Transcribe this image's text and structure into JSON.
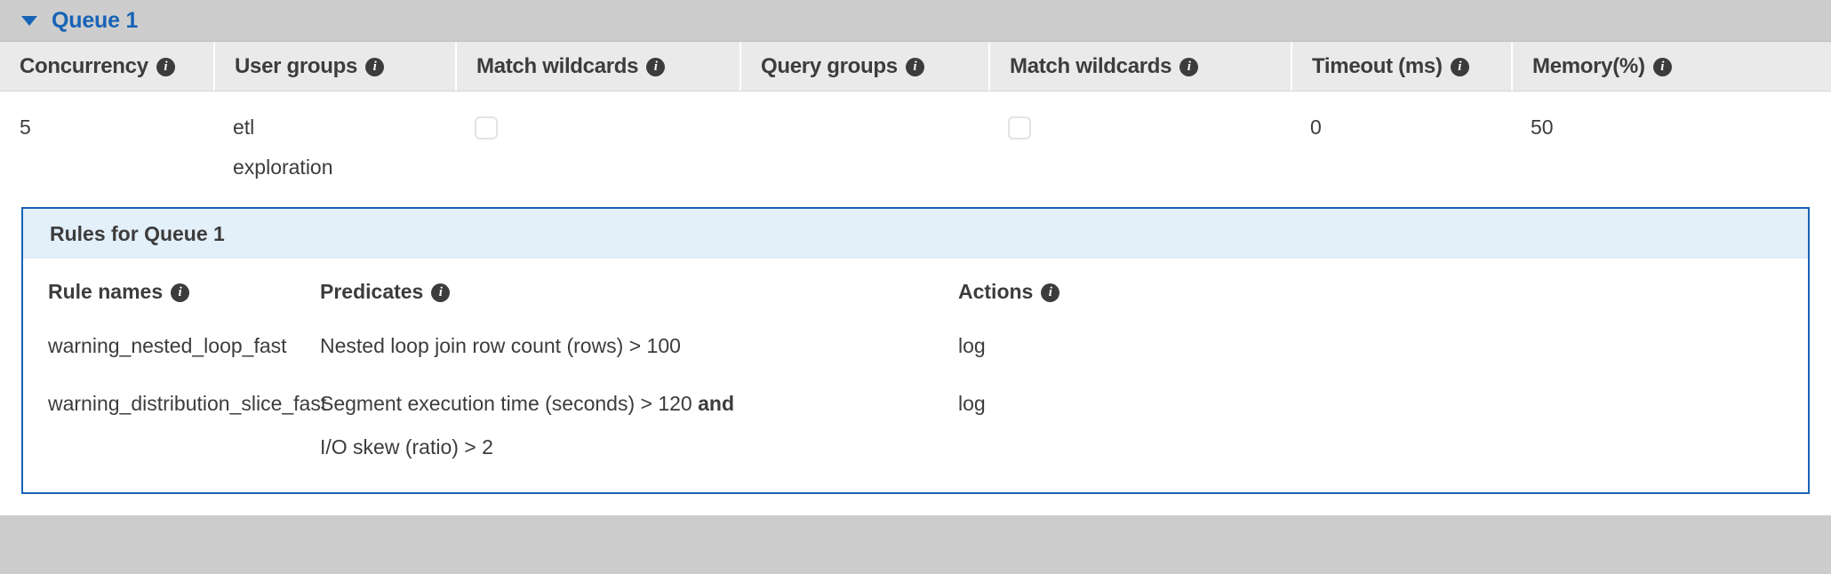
{
  "queue": {
    "title": "Queue 1",
    "disclosure_icon": "chevron-down-icon",
    "expanded": true,
    "accent_color": "#1763b6",
    "header_bg": "#cdcdcd"
  },
  "main_table": {
    "info_icon_glyph": "i",
    "columns": [
      {
        "label": "Concurrency",
        "info_icon": "info-icon"
      },
      {
        "label": "User groups",
        "info_icon": "info-icon"
      },
      {
        "label": "Match wildcards",
        "info_icon": "info-icon"
      },
      {
        "label": "Query groups",
        "info_icon": "info-icon"
      },
      {
        "label": "Match wildcards",
        "info_icon": "info-icon"
      },
      {
        "label": "Timeout (ms)",
        "info_icon": "info-icon"
      },
      {
        "label": "Memory(%)",
        "info_icon": "info-icon"
      }
    ],
    "row": {
      "concurrency": "5",
      "user_groups": [
        "etl",
        "exploration"
      ],
      "user_groups_match_wildcards": false,
      "query_groups": "",
      "query_groups_match_wildcards": false,
      "timeout_ms": "0",
      "memory_percent": "50"
    }
  },
  "rules_panel": {
    "title": "Rules for Queue 1",
    "border_color": "#1763b6",
    "header_bg": "#e3eff9",
    "columns": [
      {
        "label": "Rule names",
        "info_icon": "info-icon"
      },
      {
        "label": "Predicates",
        "info_icon": "info-icon"
      },
      {
        "label": "Actions",
        "info_icon": "info-icon"
      }
    ],
    "rows": [
      {
        "rule_name": "warning_nested_loop_fast",
        "predicate_lines": [
          {
            "text": "Nested loop join row count (rows) > 100",
            "operator": ""
          }
        ],
        "action": "log"
      },
      {
        "rule_name": "warning_distribution_slice_fast",
        "predicate_lines": [
          {
            "text": "Segment execution time (seconds) > 120 ",
            "operator": "and"
          },
          {
            "text": "I/O skew (ratio) > 2",
            "operator": ""
          }
        ],
        "action": "log"
      }
    ]
  }
}
